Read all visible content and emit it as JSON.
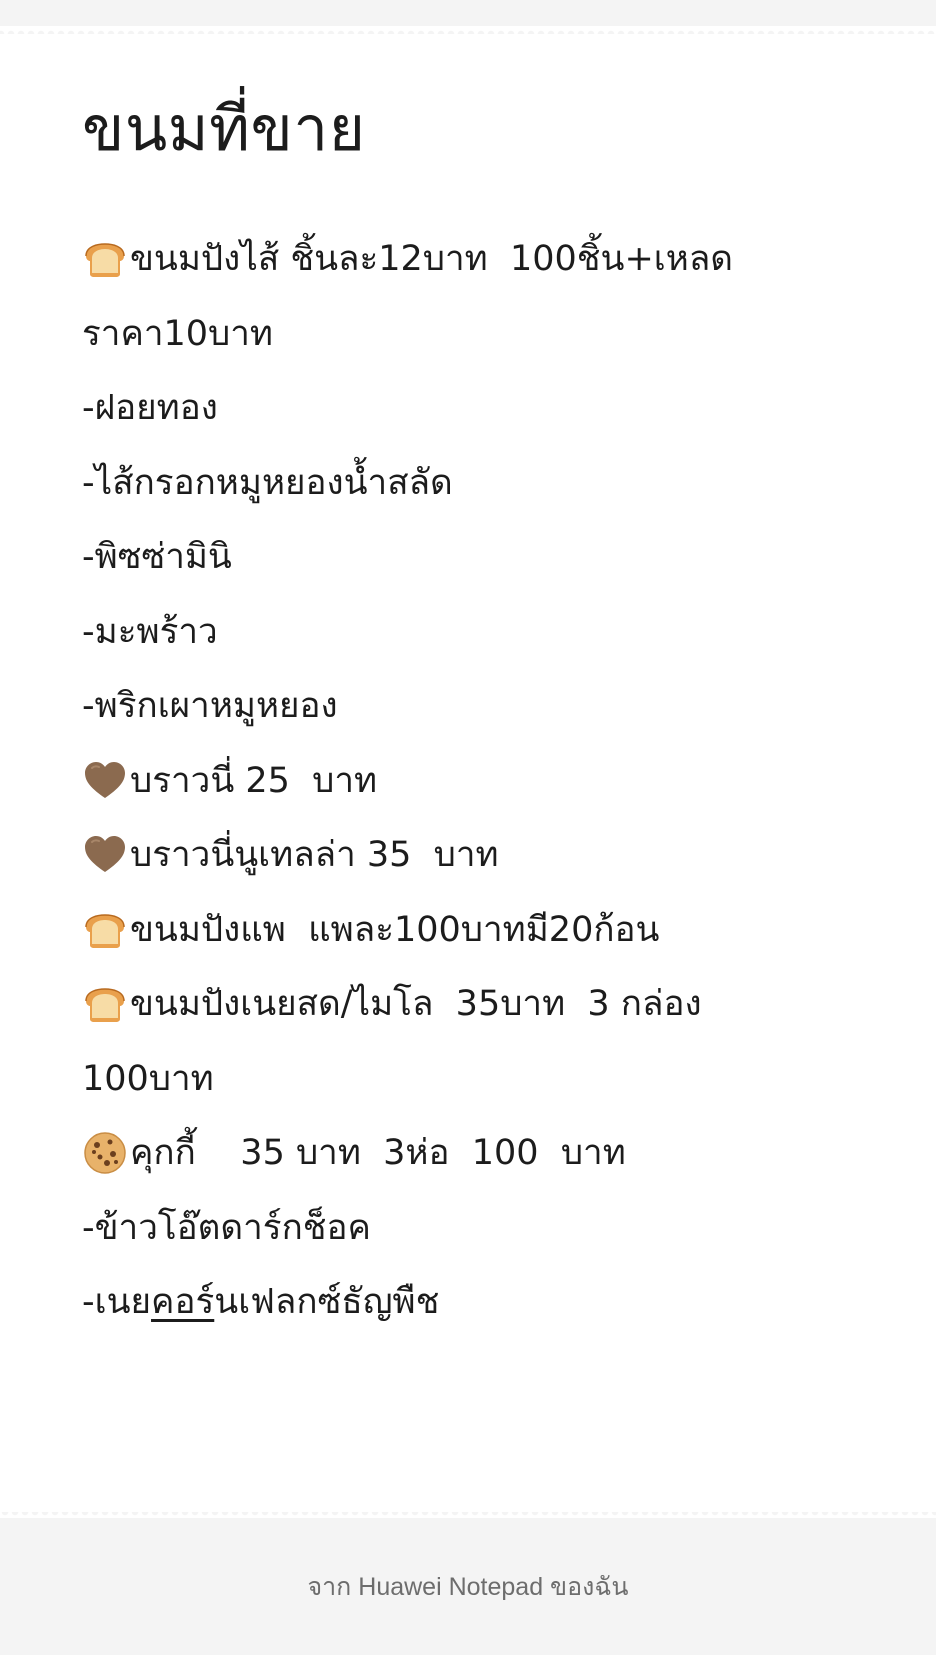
{
  "note": {
    "title": "ขนมที่ขาย",
    "lines": [
      {
        "icon": "bread-icon",
        "text": "ขนมปังไส้ ชิ้นละ12บาท  100ชิ้น+เหลด"
      },
      {
        "icon": "",
        "text": "ราคา10บาท"
      },
      {
        "icon": "",
        "text": "-ฝอยทอง"
      },
      {
        "icon": "",
        "text": "-ไส้กรอกหมูหยองน้ำสลัด"
      },
      {
        "icon": "",
        "text": "-พิซซ่ามินิ"
      },
      {
        "icon": "",
        "text": "-มะพร้าว"
      },
      {
        "icon": "",
        "text": "-พริกเผาหมูหยอง"
      },
      {
        "icon": "brown-heart-icon",
        "text": "บราวนี่ 25  บาท"
      },
      {
        "icon": "brown-heart-icon",
        "text": "บราวนี่นูเทลล่า 35  บาท"
      },
      {
        "icon": "bread-icon",
        "text": "ขนมปังแพ  แพละ100บาทมี20ก้อน"
      },
      {
        "icon": "bread-icon",
        "text": "ขนมปังเนยสด/ไมโล  35บาท  3 กล่อง"
      },
      {
        "icon": "",
        "text": "100บาท"
      },
      {
        "icon": "cookie-icon",
        "text": "คุกกี้    35 บาท  3ห่อ  100  บาท"
      },
      {
        "icon": "",
        "text": "-ข้าวโอ๊ตดาร์กช็อค"
      }
    ],
    "last_line": {
      "prefix": "-เนย",
      "underlined": "คอร์",
      "suffix": "นเฟลกซ์ธัญพืช"
    }
  },
  "footer": {
    "text": "จาก Huawei Notepad ของฉัน"
  },
  "colors": {
    "background": "#f4f4f4",
    "card": "#ffffff",
    "text": "#1c1c1c",
    "footer_text": "#6d6d6d"
  }
}
